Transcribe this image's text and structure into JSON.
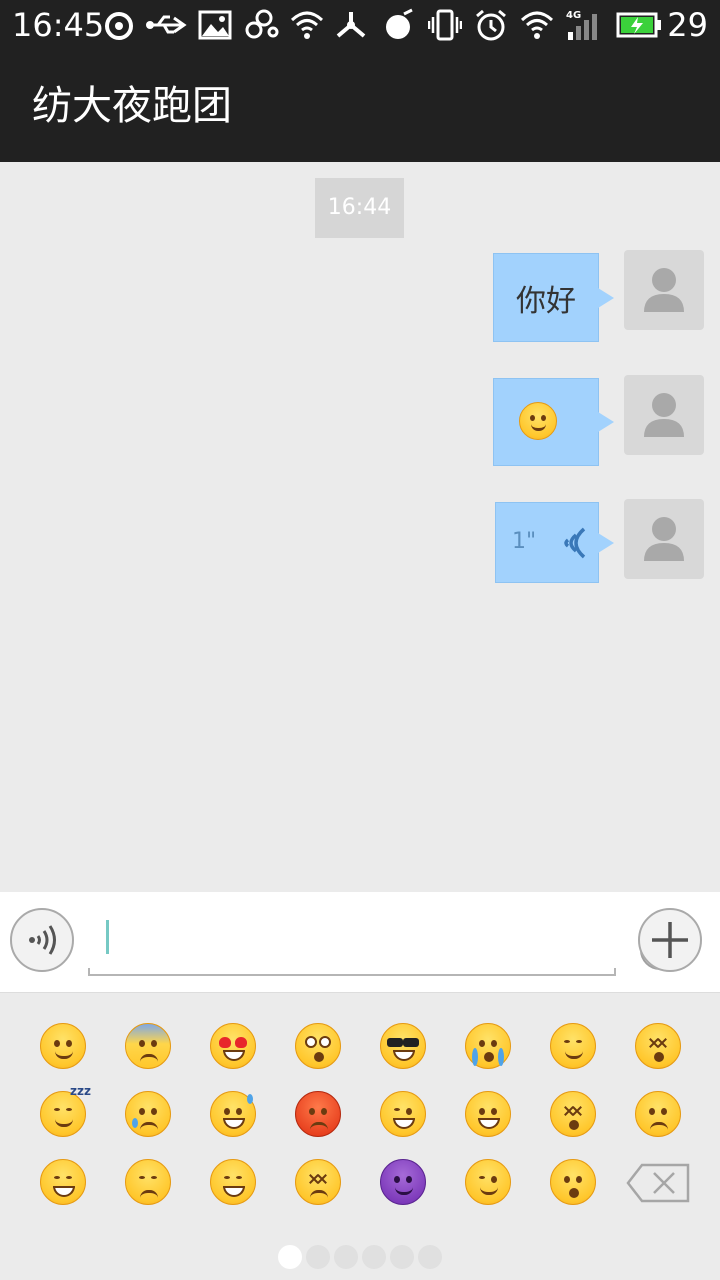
{
  "status_bar": {
    "time": "16:45",
    "battery_percent": "29",
    "network_label": "4G",
    "icons": [
      "netease-music-icon",
      "usb-icon",
      "image-icon",
      "link-icon",
      "wifi-icon",
      "share-icon",
      "music-icon",
      "vibrate-icon",
      "alarm-icon",
      "wifi-icon",
      "signal-icon",
      "battery-charging-icon"
    ]
  },
  "app_bar": {
    "title": "纺大夜跑团"
  },
  "chat": {
    "timestamp": "16:44",
    "messages": [
      {
        "type": "text",
        "content": "你好",
        "sender": "me"
      },
      {
        "type": "emoji",
        "content": "smile",
        "sender": "me"
      },
      {
        "type": "voice",
        "duration": "1\"",
        "sender": "me"
      }
    ]
  },
  "input_bar": {
    "value": "",
    "placeholder": "",
    "voice_button_icon": "voice-icon",
    "emoji_button_icon": "smiley-icon",
    "add_button_icon": "plus-icon"
  },
  "emoji_panel": {
    "rows": [
      [
        "smile",
        "fearful",
        "heart-eyes",
        "flushed",
        "sunglasses",
        "sob",
        "relieved",
        "dizzy"
      ],
      [
        "sleeping",
        "cry",
        "sweat-smile",
        "angry",
        "tongue-wink",
        "grin",
        "astonished-x",
        "worried"
      ],
      [
        "triumph",
        "disappointed",
        "tired",
        "confounded",
        "devil",
        "wink",
        "hushed",
        "delete"
      ]
    ],
    "page_count": 6,
    "active_page": 1
  },
  "colors": {
    "bar": "#212121",
    "background": "#ebebeb",
    "bubble": "#a2d2fd",
    "caret": "#76c9c4"
  }
}
